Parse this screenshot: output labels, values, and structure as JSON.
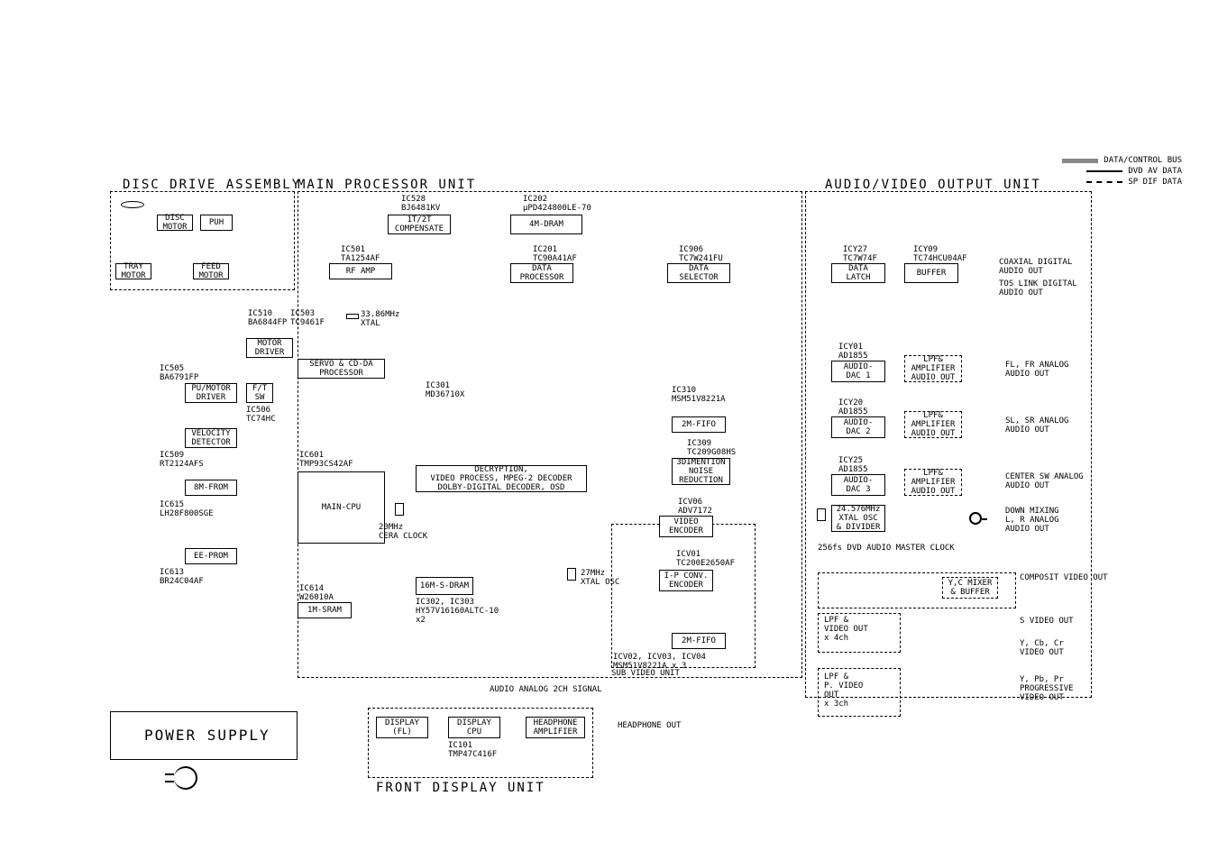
{
  "sections": {
    "disc_drive": "DISC DRIVE ASSEMBLY",
    "main_proc": "MAIN PROCESSOR UNIT",
    "av_out": "AUDIO/VIDEO OUTPUT UNIT",
    "power": "POWER SUPPLY",
    "front_display": "FRONT DISPLAY UNIT",
    "sub_video": "SUB VIDEO UNIT"
  },
  "legend": {
    "data_bus": "DATA/CONTROL BUS",
    "dvd_av": "DVD AV DATA",
    "sp_dif": "SP DIF DATA"
  },
  "ic_labels": {
    "ic528": "IC528\nBJ6481KV",
    "ic202": "IC202\nµPD424800LE-70",
    "ic501": "IC501\nTA1254AF",
    "ic201": "IC201\nTC90A41AF",
    "ic906": "IC906\nTC7W241FU",
    "icy27": "ICY27\nTC7W74F",
    "icy09": "ICY09\nTC74HCU04AF",
    "ic510": "IC510\nBA6844FP",
    "ic503": "IC503\nTC9461F",
    "ic505": "IC505\nBA6791FP",
    "ic506": "IC506\nTC74HC",
    "ic509": "IC509\nRT2124AFS",
    "ic615": "IC615\nLH28F800SGE",
    "ic613": "IC613\nBR24C04AF",
    "ic601": "IC601\nTMP93CS42AF",
    "ic614": "IC614\nW26010A",
    "ic301": "IC301\nMD36710X",
    "ic302_303": "IC302, IC303\nHY57V16160ALTC-10\nx2",
    "ic310": "IC310\nMSM51V8221A",
    "ic309": "IC309\nTC209G08HS",
    "icv06": "ICV06\nADV7172",
    "icv01": "ICV01\nTC200E2650AF",
    "icv02_04": "ICV02, ICV03, ICV04\nMSM51V8221A x 3",
    "icy01": "ICY01\nAD1855",
    "icy20": "ICY20\nAD1855",
    "icy25": "ICY25\nAD1855",
    "ic101": "IC101\nTMP47C416F",
    "xtal_3386": "33.86MHz\nXTAL",
    "cera_20m": "20MHz\nCERA CLOCK",
    "xtal_27m": "27MHz\nXTAL OSC",
    "xtal_24576": "24.576MHz\nXTAL OSC\n& DIVIDER",
    "master_clk": "256fs DVD AUDIO MASTER CLOCK"
  },
  "blocks": {
    "disc_motor": "DISC\nMOTOR",
    "puh": "PUH",
    "tray_motor": "TRAY\nMOTOR",
    "feed_motor": "FEED\nMOTOR",
    "1t2t": "1T/2T\nCOMPENSATE",
    "4m_dram": "4M-DRAM",
    "rf_amp": "RF AMP",
    "data_proc": "DATA\nPROCESSOR",
    "data_sel": "DATA\nSELECTOR",
    "data_latch": "DATA\nLATCH",
    "buffer": "BUFFER",
    "motor_driver": "MOTOR\nDRIVER",
    "servo": "SERVO & CD-DA\nPROCESSOR",
    "pu_motor_driver": "PU/MOTOR\nDRIVER",
    "ft_sw": "F/T\nSW",
    "velocity": "VELOCITY\nDETECTOR",
    "8m_from": "8M-FROM",
    "main_cpu": "MAIN-CPU",
    "ee_prom": "EE-PROM",
    "1m_sram": "1M-SRAM",
    "decryption": "DECRYPTION,\nVIDEO PROCESS, MPEG-2 DECODER\nDOLBY-DIGITAL DECODER, OSD",
    "16m_sdram": "16M-S-DRAM",
    "2m_fifo_1": "2M-FIFO",
    "3d_noise": "3DIMENTION\nNOISE\nREDUCTION",
    "video_enc": "VIDEO\nENCODER",
    "ip_conv": "I-P CONV.\nENCODER",
    "2m_fifo_2": "2M-FIFO",
    "audio_dac1": "AUDIO-\nDAC 1",
    "audio_dac2": "AUDIO-\nDAC 2",
    "audio_dac3": "AUDIO-\nDAC 3",
    "lpf_amp": "LPF&\nAMPLIFIER\nAUDIO OUT",
    "yc_mixer": "Y,C MIXER\n& BUFFER",
    "lpf_video_4ch": "LPF &\nVIDEO OUT\nx 4ch",
    "lpf_pvideo_3ch": "LPF &\nP. VIDEO\nOUT\nx 3ch",
    "display_fl": "DISPLAY\n(FL)",
    "display_cpu": "DISPLAY\nCPU",
    "headphone_amp": "HEADPHONE\nAMPLIFIER"
  },
  "outputs": {
    "coaxial": "COAXIAL DIGITAL\nAUDIO OUT",
    "toslink": "TOS LINK DIGITAL\nAUDIO OUT",
    "fl_fr": "FL, FR ANALOG\nAUDIO OUT",
    "sl_sr": "SL, SR ANALOG\nAUDIO OUT",
    "center_sw": "CENTER SW ANALOG\nAUDIO OUT",
    "down_mix": "DOWN MIXING\nL, R ANALOG\nAUDIO OUT",
    "composite": "COMPOSIT VIDEO OUT",
    "svideo": "S VIDEO OUT",
    "ycbcr": "Y, Cb, Cr\nVIDEO OUT",
    "ypbpr": "Y, Pb, Pr\nPROGRESSIVE\nVIDEO OUT",
    "headphone": "HEADPHONE OUT",
    "audio_2ch": "AUDIO ANALOG 2CH SIGNAL"
  }
}
